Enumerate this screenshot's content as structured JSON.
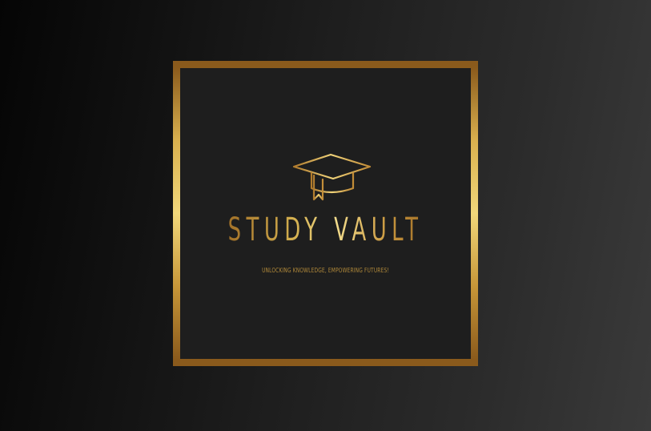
{
  "logo": {
    "title": "STUDY VAULT",
    "tagline": "UNLOCKING KNOWLEDGE, EMPOWERING FUTURES!",
    "icon": "graduation-cap-icon"
  },
  "colors": {
    "background": "#1e1e1e",
    "gold_light": "#f1d77a",
    "gold_mid": "#d2b04f",
    "gold_dark": "#8a5a1c"
  }
}
